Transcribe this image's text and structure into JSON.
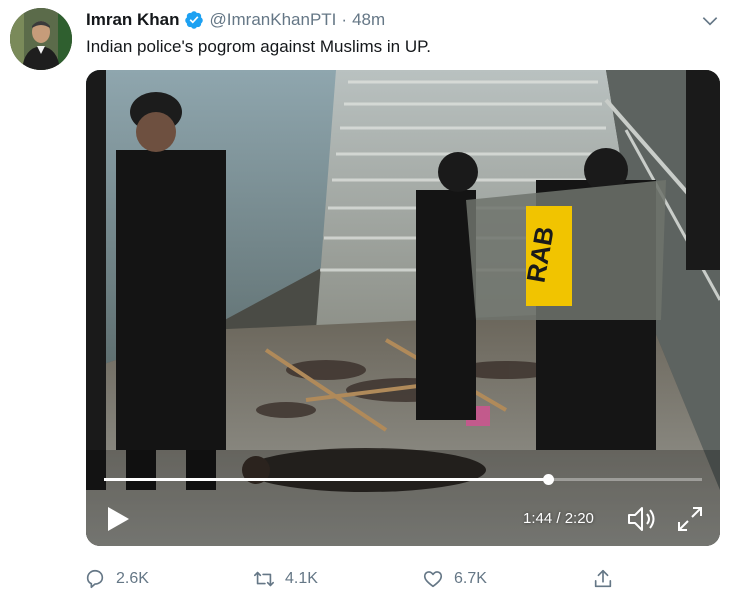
{
  "tweet": {
    "author_name": "Imran Khan",
    "handle": "@ImranKhanPTI",
    "separator": "·",
    "time": "48m",
    "text": "Indian police's pogrom against Muslims in UP.",
    "verified": true
  },
  "media": {
    "shield_text": "RAB",
    "current_time": "1:44",
    "duration": "2:20",
    "time_display": "1:44 / 2:20",
    "progress_fraction": 0.742
  },
  "actions": {
    "replies": "2.6K",
    "retweets": "4.1K",
    "likes": "6.7K"
  },
  "colors": {
    "accent": "#1da1f2",
    "muted": "#657786",
    "text": "#14171a"
  },
  "icons": [
    "avatar",
    "verified-badge-icon",
    "chevron-down-icon",
    "play-icon",
    "volume-icon",
    "fullscreen-icon",
    "reply-icon",
    "retweet-icon",
    "like-icon",
    "share-icon"
  ]
}
